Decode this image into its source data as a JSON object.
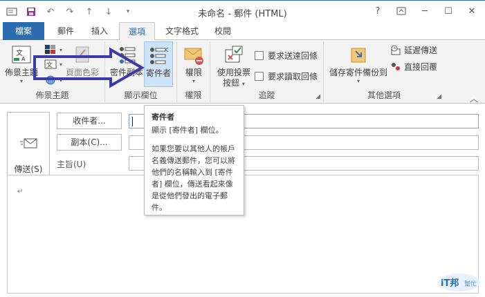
{
  "window": {
    "title": "未命名 - 郵件 (HTML)",
    "help": "?",
    "minimize": "─",
    "maximize": "☐",
    "close": "✕"
  },
  "tabs": [
    {
      "label": "檔案"
    },
    {
      "label": "郵件"
    },
    {
      "label": "插入"
    },
    {
      "label": "選項"
    },
    {
      "label": "文字格式"
    },
    {
      "label": "校閱"
    }
  ],
  "ribbon": {
    "theme_group": {
      "label": "佈景主題",
      "theme_button": "佈景主題",
      "page_color": "頁面色彩"
    },
    "show_fields_group": {
      "label": "顯示欄位",
      "bcc_button": "密件副本",
      "from_button": "寄件者"
    },
    "permission_group": {
      "label": "權限",
      "permission_button": "權限"
    },
    "tracking_group": {
      "label": "追蹤",
      "voting_button_l1": "使用投票",
      "voting_button_l2": "按鈕",
      "delivery_receipt": "要求送達回條",
      "read_receipt": "要求讀取回條"
    },
    "more_group": {
      "label": "其他選項",
      "save_sent_l1": "儲存寄件備份到",
      "delay_delivery": "延遲傳送",
      "direct_replies": "直接回覆"
    }
  },
  "compose": {
    "send_label": "傳送(S)",
    "to_button": "收件者...",
    "cc_button": "副本(C)...",
    "subject_label": "主旨(U)",
    "paragraph_mark": "↵"
  },
  "tooltip": {
    "title": "寄件者",
    "line1": "顯示 [寄件者] 欄位。",
    "body": "如果您要以其他人的帳戶名義傳送郵件，您可以將他們的名稱輸入到 [寄件者] 欄位，傳送看起來像是從他們發出的電子郵件。"
  },
  "watermark": {
    "text1": "iT邦",
    "text2": "幫忙"
  },
  "colors": {
    "accent": "#2b6cb0",
    "arrow": "#3a3aa8",
    "selected": "#cde3f7"
  }
}
